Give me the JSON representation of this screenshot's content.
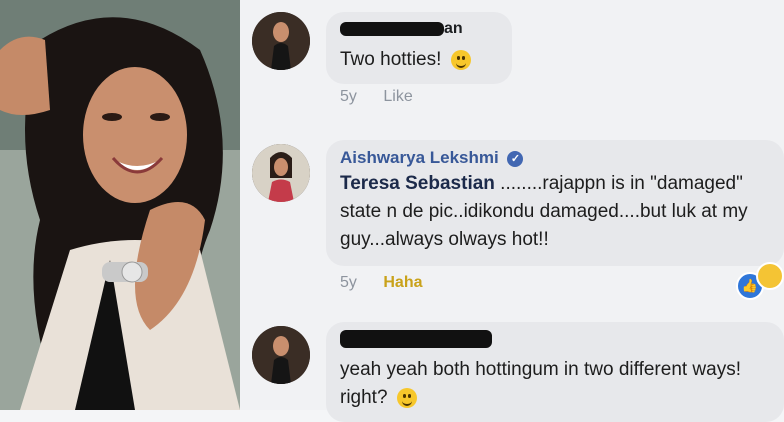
{
  "comments": [
    {
      "author_suffix": "an",
      "text": "Two hotties!",
      "time": "5y",
      "action": "Like"
    },
    {
      "author": "Aishwarya Lekshmi",
      "mention": "Teresa Sebastian",
      "text_line1": " ........rajappn is in \"damaged\"",
      "text_line2": "state n de pic..idikondu damaged....but luk at my",
      "text_line3": "guy...always olways hot!!",
      "time": "5y",
      "action": "Haha"
    },
    {
      "text_line1": "yeah yeah both hottingum in two different ways!",
      "text_line2": "right?"
    }
  ],
  "icons": {
    "emoji": "smile-emoji-icon",
    "verified": "verified-badge-icon",
    "reaction_like": "thumbs-up-icon",
    "reaction_haha": "laughing-emoji-icon"
  },
  "colors": {
    "link_name": "#385898",
    "haha": "#c9a21a",
    "meta": "#8d949e",
    "bubble": "#e7e8eb"
  }
}
